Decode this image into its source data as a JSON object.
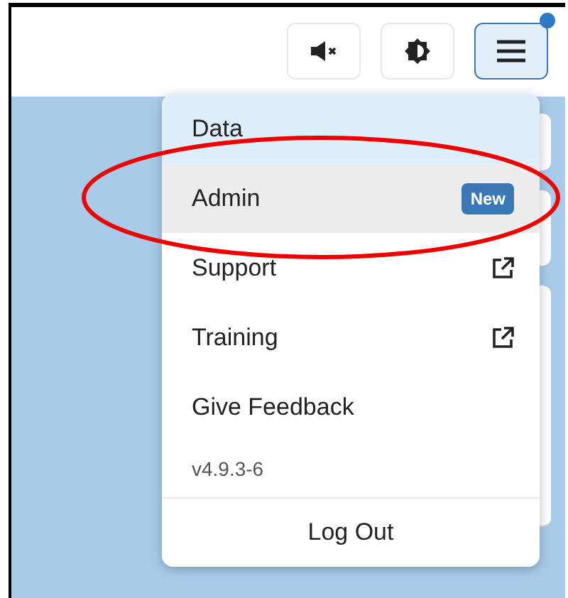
{
  "header": {
    "buttons": [
      {
        "kind": "mute",
        "active": false
      },
      {
        "kind": "brightness",
        "active": false
      },
      {
        "kind": "menu",
        "active": true,
        "notification": true
      }
    ]
  },
  "menu": {
    "items": [
      {
        "label": "Data",
        "kind": "link",
        "selected": true,
        "highlighted": false
      },
      {
        "label": "Admin",
        "kind": "link",
        "selected": false,
        "highlighted": true,
        "badge": "New"
      },
      {
        "label": "Support",
        "kind": "external",
        "selected": false,
        "highlighted": false
      },
      {
        "label": "Training",
        "kind": "external",
        "selected": false,
        "highlighted": false
      },
      {
        "label": "Give Feedback",
        "kind": "link",
        "selected": false,
        "highlighted": false
      }
    ],
    "version": "v4.9.3-6",
    "logout": "Log Out"
  },
  "annotation": {
    "kind": "ellipse"
  }
}
